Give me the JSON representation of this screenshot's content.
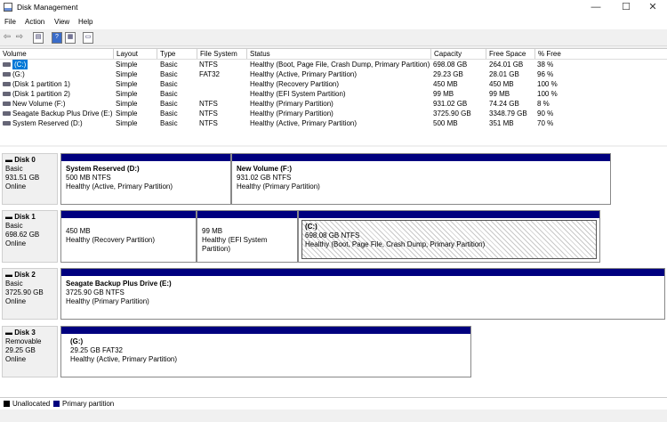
{
  "window": {
    "title": "Disk Management",
    "controls": [
      "—",
      "☐",
      "✕"
    ]
  },
  "menu": [
    "File",
    "Action",
    "View",
    "Help"
  ],
  "toolbar": {
    "icons": [
      "back-icon",
      "forward-icon",
      "properties-icon",
      "help-icon",
      "settings-icon"
    ]
  },
  "volumes": {
    "headers": [
      "Volume",
      "Layout",
      "Type",
      "File System",
      "Status",
      "Capacity",
      "Free Space",
      "% Free"
    ],
    "rows": [
      [
        "(C:)",
        "Simple",
        "Basic",
        "NTFS",
        "Healthy (Boot, Page File, Crash Dump, Primary Partition)",
        "698.08 GB",
        "264.01 GB",
        "38 %"
      ],
      [
        "(G:)",
        "Simple",
        "Basic",
        "FAT32",
        "Healthy (Active, Primary Partition)",
        "29.23 GB",
        "28.01 GB",
        "96 %"
      ],
      [
        "(Disk 1 partition 1)",
        "Simple",
        "Basic",
        "",
        "Healthy (Recovery Partition)",
        "450 MB",
        "450 MB",
        "100 %"
      ],
      [
        "(Disk 1 partition 2)",
        "Simple",
        "Basic",
        "",
        "Healthy (EFI System Partition)",
        "99 MB",
        "99 MB",
        "100 %"
      ],
      [
        "New Volume (F:)",
        "Simple",
        "Basic",
        "NTFS",
        "Healthy (Primary Partition)",
        "931.02 GB",
        "74.24 GB",
        "8 %"
      ],
      [
        "Seagate Backup Plus Drive (E:)",
        "Simple",
        "Basic",
        "NTFS",
        "Healthy (Primary Partition)",
        "3725.90 GB",
        "3348.79 GB",
        "90 %"
      ],
      [
        "System Reserved (D:)",
        "Simple",
        "Basic",
        "NTFS",
        "Healthy (Active, Primary Partition)",
        "500 MB",
        "351 MB",
        "70 %"
      ]
    ]
  },
  "disks": [
    {
      "name": "Disk 0",
      "type": "Basic",
      "size": "931.51 GB",
      "state": "Online",
      "partitions": [
        {
          "name": "System Reserved  (D:)",
          "size": "500 MB NTFS",
          "status": "Healthy (Active, Primary Partition)"
        },
        {
          "name": "New Volume  (F:)",
          "size": "931.02 GB NTFS",
          "status": "Healthy (Primary Partition)"
        }
      ]
    },
    {
      "name": "Disk 1",
      "type": "Basic",
      "size": "698.62 GB",
      "state": "Online",
      "partitions": [
        {
          "name": "",
          "size": "450 MB",
          "status": "Healthy (Recovery Partition)"
        },
        {
          "name": "",
          "size": "99 MB",
          "status": "Healthy (EFI System Partition)"
        },
        {
          "name": "(C:)",
          "size": "698.08 GB NTFS",
          "status": "Healthy (Boot, Page File, Crash Dump, Primary Partition)"
        }
      ]
    },
    {
      "name": "Disk 2",
      "type": "Basic",
      "size": "3725.90 GB",
      "state": "Online",
      "partitions": [
        {
          "name": "Seagate Backup Plus Drive  (E:)",
          "size": "3725.90 GB NTFS",
          "status": "Healthy (Primary Partition)"
        }
      ]
    },
    {
      "name": "Disk 3",
      "type": "Removable",
      "size": "29.25 GB",
      "state": "Online",
      "partitions": [
        {
          "name": "(G:)",
          "size": "29.25 GB FAT32",
          "status": "Healthy (Active, Primary Partition)"
        }
      ]
    }
  ],
  "legend": [
    {
      "label": "Unallocated",
      "color": "#000000"
    },
    {
      "label": "Primary partition",
      "color": "#00007f"
    }
  ],
  "colors": {
    "partition_bar": "#00007f",
    "selection": "#0078d7"
  }
}
